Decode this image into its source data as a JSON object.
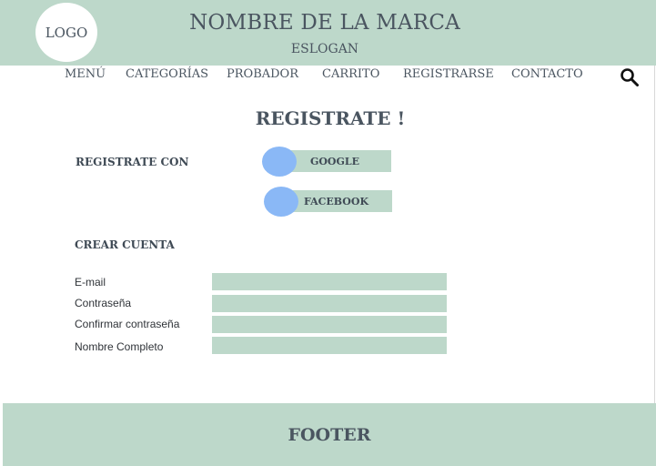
{
  "header": {
    "logo": "LOGO",
    "brand": "NOMBRE DE LA MARCA",
    "slogan": "ESLOGAN"
  },
  "nav": {
    "items": [
      "MENÚ",
      "CATEGORÍAS",
      "PROBADOR",
      "CARRITO",
      "REGISTRARSE",
      "CONTACTO"
    ],
    "search_icon": "search-icon"
  },
  "main": {
    "title": "REGISTRATE !",
    "register_with_label": "REGISTRATE CON",
    "social": {
      "google": "GOOGLE",
      "facebook": "FACEBOOK"
    },
    "create_account_label": "CREAR CUENTA",
    "fields": [
      {
        "label": "E-mail",
        "value": ""
      },
      {
        "label": "Contraseña",
        "value": ""
      },
      {
        "label": "Confirmar contraseña",
        "value": ""
      },
      {
        "label": "Nombre Completo",
        "value": ""
      }
    ]
  },
  "footer": {
    "label": "FOOTER"
  },
  "colors": {
    "accent": "#bdd8ca",
    "social_dot": "#8ab8f6",
    "text": "#4a5560"
  }
}
